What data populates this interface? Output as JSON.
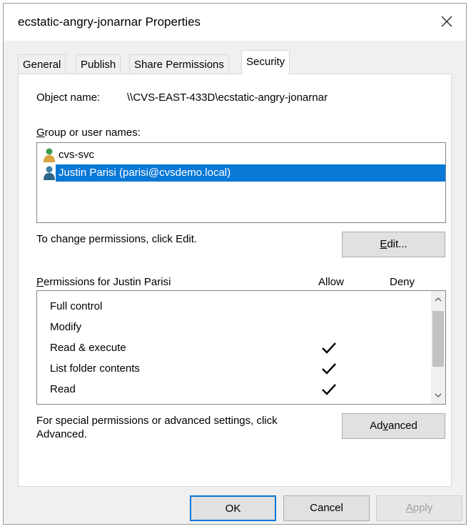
{
  "window": {
    "title": "ecstatic-angry-jonarnar Properties",
    "close_icon": "close-icon"
  },
  "tabs": [
    {
      "label": "General",
      "active": false
    },
    {
      "label": "Publish",
      "active": false
    },
    {
      "label": "Share Permissions",
      "active": false
    },
    {
      "label": "Security",
      "active": true
    }
  ],
  "object": {
    "label": "Object name:",
    "value": "\\\\CVS-EAST-433D\\ecstatic-angry-jonarnar"
  },
  "groups": {
    "label_prefix": "",
    "label_underlined": "G",
    "label_rest": "roup or user names:",
    "items": [
      {
        "name": "cvs-svc",
        "icon": "user-icon",
        "selected": false
      },
      {
        "name": "Justin Parisi (parisi@cvsdemo.local)",
        "icon": "user-icon",
        "selected": true
      }
    ]
  },
  "change": {
    "text": "To change permissions, click Edit.",
    "edit_prefix": "",
    "edit_underlined": "E",
    "edit_rest": "dit..."
  },
  "permissions": {
    "label_underlined": "P",
    "label_rest": "ermissions for Justin Parisi",
    "allow_header": "Allow",
    "deny_header": "Deny",
    "rows": [
      {
        "name": "Full control",
        "allow": false,
        "deny": false
      },
      {
        "name": "Modify",
        "allow": false,
        "deny": false
      },
      {
        "name": "Read & execute",
        "allow": true,
        "deny": false
      },
      {
        "name": "List folder contents",
        "allow": true,
        "deny": false
      },
      {
        "name": "Read",
        "allow": true,
        "deny": false
      }
    ]
  },
  "advanced": {
    "text_line1": "For special permissions or advanced settings, click",
    "text_line2": "Advanced.",
    "btn_prefix": "Ad",
    "btn_underlined": "v",
    "btn_rest": "anced"
  },
  "footer": {
    "ok": "OK",
    "cancel": "Cancel",
    "apply_underlined": "A",
    "apply_rest": "pply"
  },
  "colors": {
    "selection": "#0a78d7",
    "dialog_bg": "#f0f0f0",
    "accent_border": "#0078d7"
  }
}
